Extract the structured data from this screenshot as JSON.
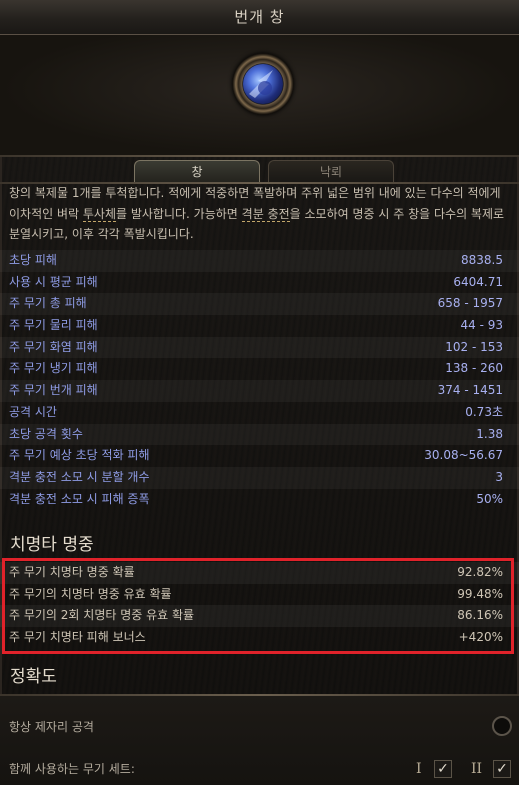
{
  "window": {
    "title": "번개 창"
  },
  "tabs": [
    {
      "label": "창",
      "active": true
    },
    {
      "label": "낙뢰",
      "active": false
    }
  ],
  "description": {
    "part1": "창의 복제물 1개를 투척합니다. 적에게 적중하면 폭발하며 주위 넓은 범위 내에 있는 다수의 적에게 이차적인 벼락 ",
    "u1": "투사체",
    "part2": "를 발사합니다. 가능하면 ",
    "u2": "격분 충전",
    "part3": "을 소모하여 명중 시 주 창을 다수의 복제로 분열시키고, 이후 각각 폭발시킵니다."
  },
  "stats": [
    {
      "label": "초당 피해",
      "value": "8838.5"
    },
    {
      "label": "사용 시 평균 피해",
      "value": "6404.71"
    },
    {
      "label": "주 무기 총 피해",
      "value": "658 - 1957"
    },
    {
      "label": "주 무기 물리 피해",
      "value": "44 - 93"
    },
    {
      "label": "주 무기 화염 피해",
      "value": "102 - 153"
    },
    {
      "label": "주 무기 냉기 피해",
      "value": "138 - 260"
    },
    {
      "label": "주 무기 번개 피해",
      "value": "374 - 1451"
    },
    {
      "label": "공격 시간",
      "value": "0.73초"
    },
    {
      "label": "초당 공격 횟수",
      "value": "1.38"
    },
    {
      "label": "주 무기 예상 초당 적화 피해",
      "value": "30.08~56.67"
    },
    {
      "label": "격분 충전 소모 시 분할 개수",
      "value": "3"
    },
    {
      "label": "격분 충전 소모 시 피해 증폭",
      "value": "50%"
    }
  ],
  "crit_section": {
    "title": "치명타 명중",
    "rows": [
      {
        "label": "주 무기 치명타 명중 확률",
        "value": "92.82%"
      },
      {
        "label": "주 무기의 치명타 명중 유효 확률",
        "value": "99.48%"
      },
      {
        "label": "주 무기의 2회 치명타 명중 유효 확률",
        "value": "86.16%"
      },
      {
        "label": "주 무기 치명타 피해 보너스",
        "value": "+420%"
      }
    ]
  },
  "accuracy_section": {
    "title": "정확도"
  },
  "options": {
    "always_in_place": "항상 제자리 공격",
    "weapon_set_label": "함께 사용하는 무기 세트:",
    "set1": "I",
    "set2": "II",
    "set1_checked": true,
    "set2_checked": true,
    "check_glyph": "✓"
  }
}
